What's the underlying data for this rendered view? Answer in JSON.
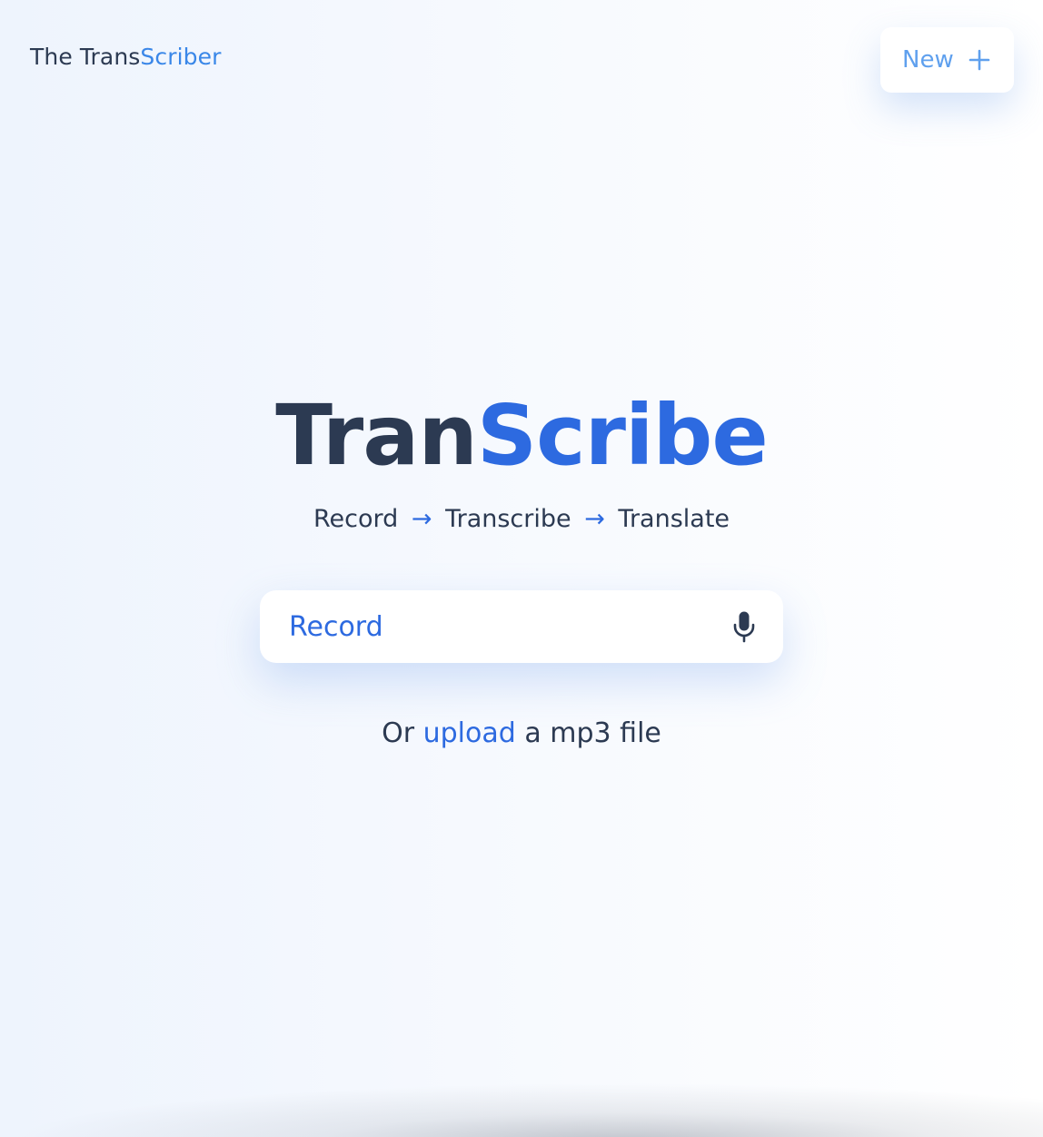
{
  "header": {
    "brand_prefix": "The Trans",
    "brand_accent": "Scriber",
    "new_button_label": "New",
    "new_button_icon": "plus-icon"
  },
  "hero": {
    "title_prefix": "Tran",
    "title_accent": "Scribe",
    "steps": [
      "Record",
      "Transcribe",
      "Translate"
    ],
    "arrow": "→"
  },
  "record": {
    "label": "Record",
    "icon": "microphone-icon"
  },
  "upload": {
    "prefix": "Or",
    "link": "upload",
    "suffix": "a mp3 file"
  },
  "colors": {
    "text": "#2c3a52",
    "accent": "#2d6ae0",
    "brand_accent": "#3a87e8",
    "new_button_text": "#5fa0ee"
  }
}
